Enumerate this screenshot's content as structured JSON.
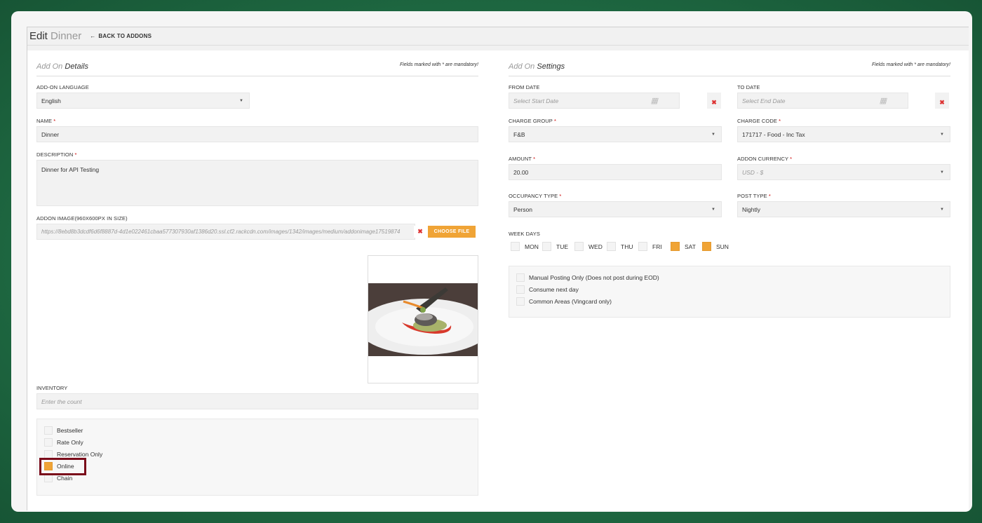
{
  "header": {
    "title_main": "Edit",
    "title_sub": "Dinner",
    "back_label": "BACK TO ADDONS"
  },
  "details": {
    "section_title_a": "Add On",
    "section_title_b": "Details",
    "mandatory_note": "Fields marked with * are mandatory!",
    "language_label": "ADD-ON LANGUAGE",
    "language_value": "English",
    "name_label": "NAME",
    "name_value": "Dinner",
    "description_label": "DESCRIPTION",
    "description_value": "Dinner for API Testing",
    "image_label": "ADDON IMAGE(960X600PX IN SIZE)",
    "image_url": "https://8ebd8b3dcdf6d6f8887d-4d1e022461cbaa577307930af1386d20.ssl.cf2.rackcdn.com/images/1342/images/medium/addonimage17519874",
    "choose_file_label": "CHOOSE FILE",
    "inventory_label": "INVENTORY",
    "inventory_placeholder": "Enter the count",
    "flags": [
      {
        "label": "Bestseller",
        "checked": false
      },
      {
        "label": "Rate Only",
        "checked": false
      },
      {
        "label": "Reservation Only",
        "checked": false
      },
      {
        "label": "Online",
        "checked": true
      },
      {
        "label": "Chain",
        "checked": false
      }
    ]
  },
  "settings": {
    "section_title_a": "Add On",
    "section_title_b": "Settings",
    "mandatory_note": "Fields marked with * are mandatory!",
    "from_date_label": "FROM DATE",
    "from_date_placeholder": "Select Start Date",
    "to_date_label": "TO DATE",
    "to_date_placeholder": "Select End Date",
    "charge_group_label": "CHARGE GROUP",
    "charge_group_value": "F&B",
    "charge_code_label": "CHARGE CODE",
    "charge_code_value": "171717 - Food - Inc Tax",
    "amount_label": "AMOUNT",
    "amount_value": "20.00",
    "currency_label": "ADDON CURRENCY",
    "currency_value": "USD - $",
    "occupancy_label": "OCCUPANCY TYPE",
    "occupancy_value": "Person",
    "post_type_label": "POST TYPE",
    "post_type_value": "Nightly",
    "week_days_label": "WEEK DAYS",
    "week_days": [
      {
        "label": "MON",
        "checked": false
      },
      {
        "label": "TUE",
        "checked": false
      },
      {
        "label": "WED",
        "checked": false
      },
      {
        "label": "THU",
        "checked": false
      },
      {
        "label": "FRI",
        "checked": false
      },
      {
        "label": "SAT",
        "checked": true
      },
      {
        "label": "SUN",
        "checked": true
      }
    ],
    "options": [
      {
        "label": "Manual Posting Only (Does not post during EOD)",
        "checked": false
      },
      {
        "label": "Consume next day",
        "checked": false
      },
      {
        "label": "Common Areas (Vingcard only)",
        "checked": false
      }
    ]
  },
  "colors": {
    "accent": "#f0a436",
    "highlight": "#7a0a1a",
    "background": "#1f6b43"
  }
}
